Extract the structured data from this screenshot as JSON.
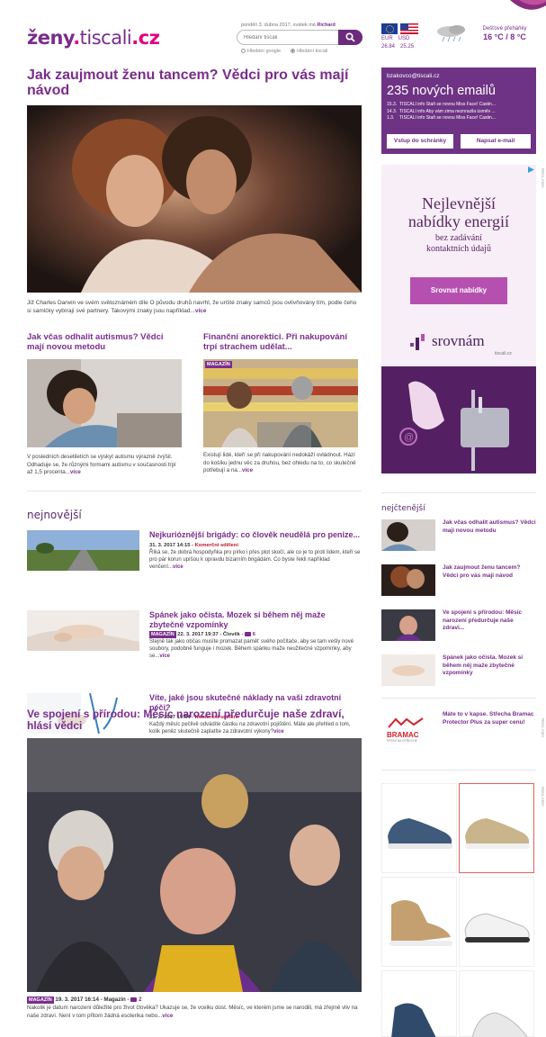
{
  "header": {
    "logo_main": "ženy",
    "logo_dot": ".",
    "logo_domain": "tiscali",
    "logo_tld": ".cz",
    "date_text": "pondělí 3. dubna 2017, svátek má",
    "nameday": "Richard",
    "search_placeholder": "Hledání tiscali",
    "radio_google": "Hledání google",
    "radio_tiscali": "Hledání tiscali",
    "currency": {
      "eur_label": "EUR",
      "usd_label": "USD",
      "eur_value": "26.84",
      "usd_value": "25.25"
    },
    "weather": {
      "desc": "Dešťové přeháňky",
      "temp": "16 °C / 8 °C"
    }
  },
  "main": {
    "title": "Jak zaujmout ženu tancem? Vědci pro vás mají návod",
    "perex": "Již Charles Darwin ve svém světoznámém díle O původu druhů navrhl, že určité znaky samců jsou ovlivňovány tím, podle čeho si samičky vybírají své partnery. Takovými znaky jsou například...",
    "more": "více",
    "sub_articles": [
      {
        "title": "Jak včas odhalit autismus? Vědci mají novou metodu",
        "badge": "",
        "perex": "V posledních desetiletích se výskyt autismu výrazně zvýšil. Odhaduje se, že různými formami autismu v současnosti trpí až 1,5 procenta...",
        "more": "více"
      },
      {
        "title": "Finanční anorektici. Při nakupování trpí strachem udělat...",
        "badge": "MAGAZÍN",
        "perex": "Existují lidé, kteří se při nakupování nedokáží ovládnout. Hází do košíku jednu věc za druhou, bez ohledu na to, co skutečně potřebují a na...",
        "more": "více"
      }
    ],
    "newest_heading": "nejnovější",
    "newest": [
      {
        "title": "Nejkurióznější brigády: co člověk neudělá pro penize...",
        "badge": "",
        "meta": "31. 3. 2017 14:15 - ",
        "category": "Komerční sdělení",
        "comments": "",
        "perex": "Říká se, že dobrá hospodyňka pro pírko i přes plot skočí, ale co je to proti lidem, kteří se pro pár korun upíšou k opravdu bizarním brigádám. Co byste řekli například venčení...",
        "more": "více"
      },
      {
        "title": "Spánek jako očista. Mozek si během něj maže zbytečné vzpomínky",
        "badge": "MAGAZÍN",
        "meta": "22. 3. 2017 19:37 - Člověk - ",
        "category": "",
        "comments": "6",
        "perex": "Stejně tak jako občas musíte promazat paměť svého počítače, aby se tam vešly nové soubory, podobně funguje i mozek. Během spánku maže neužitečné vzpomínky, aby se...",
        "more": "více"
      },
      {
        "title": "Víte, jaké jsou skutečné náklady na vaši zdravotní péči?",
        "badge": "",
        "meta": "21. 3. 2017 19:54 - ",
        "category": "Komerční sdělení",
        "comments": "",
        "perex": "Každý měsíc pečlivě odvádíte částku na zdravotní pojištění. Máte ale přehled o tom, kolik peněz skutečně zaplatíte za zdravotní výkony?",
        "more": "více"
      }
    ],
    "big": {
      "title": "Ve spojení s přírodou: Měsíc narození předurčuje naše zdraví, hlásí vědci",
      "badge": "MAGAZÍN",
      "meta": "19. 3. 2017 16:14 - Magazín - ",
      "comments": "2",
      "perex": "Nakolik je datum narození důležité pro život člověka? Ukazuje se, že vcelku dost. Měsíc, ve kterém jsme se narodili, má zřejmě vliv na naše zdraví. Není v tom přitom žádná esoterika nebo...",
      "more": "více"
    }
  },
  "sidebar": {
    "mail": {
      "address": "bzakovco@tiscali.cz",
      "count": "235 nových emailů",
      "items": [
        {
          "date": "15.3.",
          "text": "TISCALI info  Staň se novou Miss Face! Castin..."
        },
        {
          "date": "14.3.",
          "text": "TISCALI info  Aby vám zima neznrazila úsměv ..."
        },
        {
          "date": "1.3.",
          "text": "TISCALI info  Staň se novou Miss Face! Castin..."
        }
      ],
      "inbox_button": "Vstup do schránky",
      "write_button": "Napsat e-mail"
    },
    "ad1": {
      "line1": "Nejlevnější",
      "line2": "nabídky energií",
      "line3": "bez zadávání",
      "line4": "kontaktních údajů",
      "button": "Srovnat nabídky",
      "logo": "srovnám",
      "logo_sub": "tiscali.cz",
      "tag": "REKLAMA"
    },
    "popular_heading": "nejčtenější",
    "popular": [
      {
        "title": "Jak včas odhalit autismus? Vědci mají novou metodu"
      },
      {
        "title": "Jak zaujmout ženu tancem? Vědci pro vás mají návod"
      },
      {
        "title": "Ve spojení s přírodou: Měsíc narození předurčuje naše zdravi..."
      },
      {
        "title": "Spánek jako očista. Mozek si během něj maže zbytečné vzpomínky"
      }
    ],
    "bramac": {
      "logo": "BRAMAC",
      "logo_sub": "PRVNÍ NA STŘECHE",
      "text": "Máte to v kapse. Střecha Bramac Protector Plus za super cenu!",
      "tag": "REKLAMA"
    },
    "shoes_tag": "REKLAMA",
    "colors": {
      "brand": "#7a2d8c",
      "mail_bg": "#6e3384",
      "ad_bg": "#f7eef7"
    }
  }
}
